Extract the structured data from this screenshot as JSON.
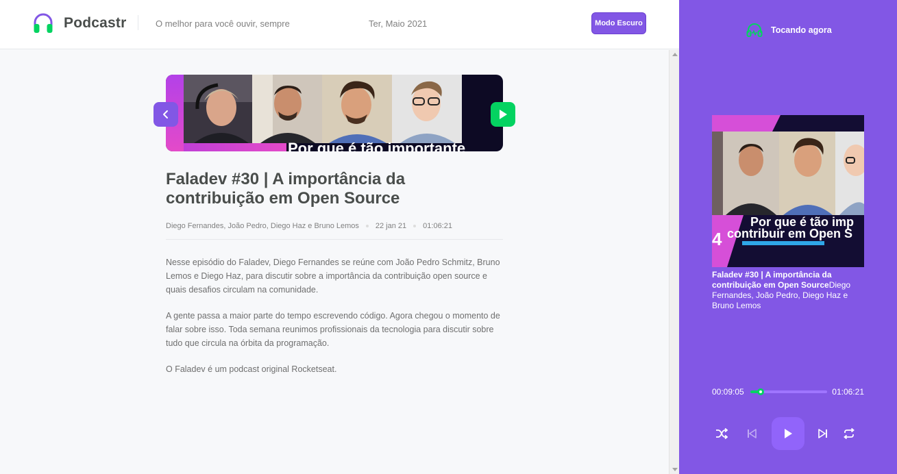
{
  "header": {
    "app_name": "Podcastr",
    "tagline": "O melhor para você ouvir, sempre",
    "date": "Ter, Maio 2021",
    "dark_mode_label": "Modo Escuro"
  },
  "episode": {
    "thumbnail_caption": "Por que é tão importante",
    "title": "Faladev #30 | A importância da contribuição em Open Source",
    "members": "Diego Fernandes, João Pedro, Diego Haz e Bruno Lemos",
    "published_at": "22 jan 21",
    "duration": "01:06:21",
    "description": [
      "Nesse episódio do Faladev, Diego Fernandes se reúne com João Pedro Schmitz, Bruno Lemos e Diego Haz, para discutir sobre a importância da contribuição open source e quais desafios circulam na comunidade.",
      "A gente passa a maior parte do tempo escrevendo código. Agora chegou o momento de falar sobre isso. Toda semana reunimos profissionais da tecnologia para discutir sobre tudo que circula na órbita da programação.",
      "O Faladev é um podcast original Rocketseat."
    ]
  },
  "player": {
    "heading": "Tocando agora",
    "cover_caption_1": "Por que é tão imp",
    "cover_caption_2": "contribuir em Open S",
    "title": "Faladev #30 | A importância da contribuição em Open Source",
    "members": "Diego Fernandes, João Pedro, Diego Haz e Bruno Lemos",
    "current_time": "00:09:05",
    "total_time": "01:06:21",
    "progress_fraction": 0.137
  },
  "colors": {
    "brand": "#8257e5",
    "accent": "#04d361",
    "background": "#f7f8fa"
  },
  "icons": {
    "logo": "headphones-icon",
    "player_heading": "headphones-icon",
    "back": "chevron-left-icon",
    "play": "play-icon",
    "shuffle": "shuffle-icon",
    "previous": "skip-previous-icon",
    "next": "skip-next-icon",
    "repeat": "repeat-icon"
  }
}
